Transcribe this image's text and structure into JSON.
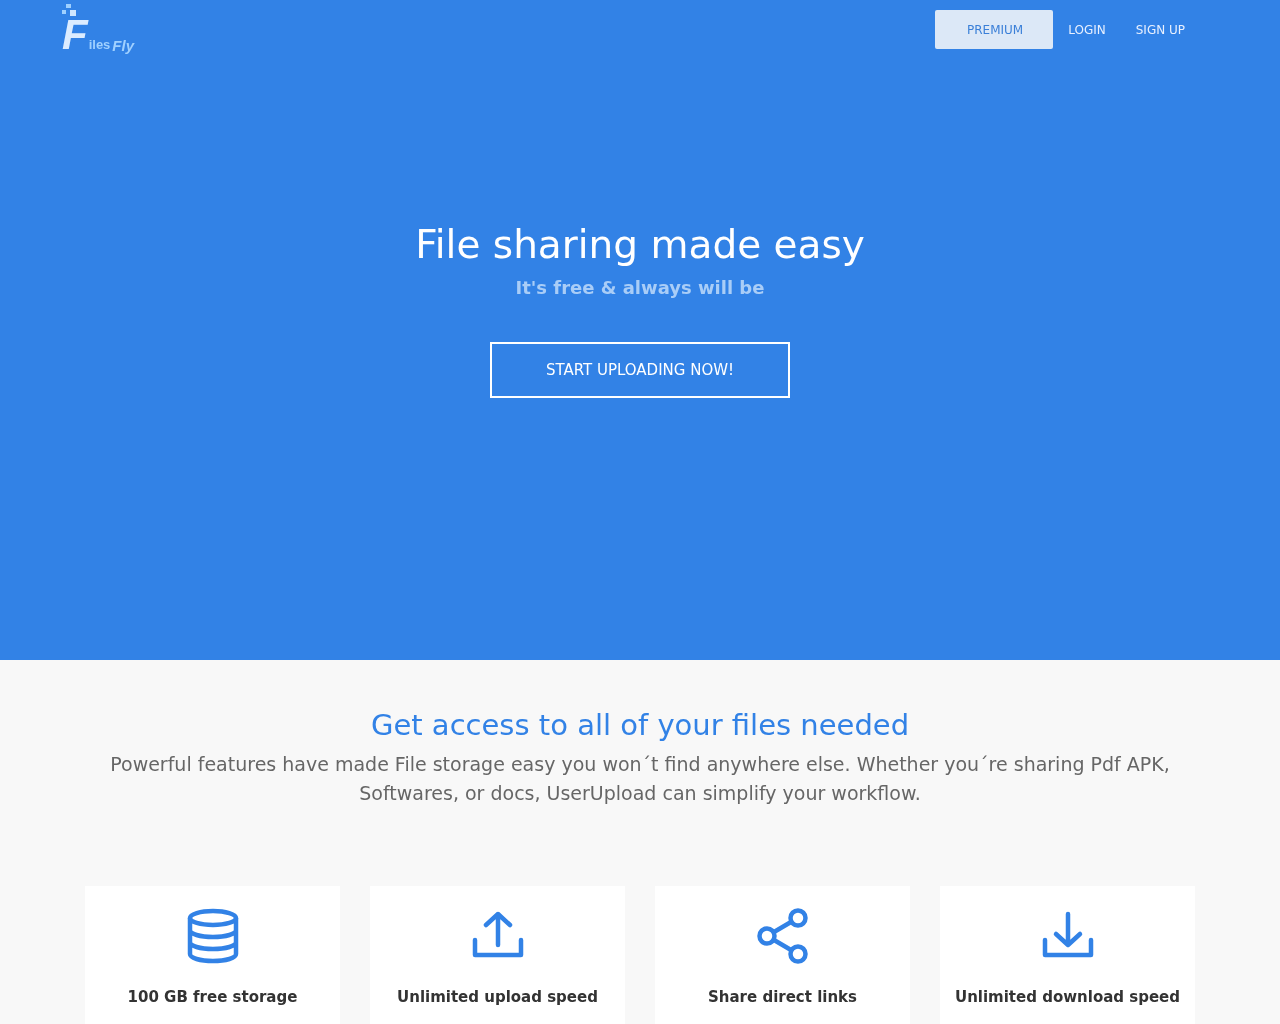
{
  "logo": {
    "initial": "F",
    "rest": "iles",
    "accent": "Fly"
  },
  "nav": [
    {
      "label": "PREMIUM",
      "kind": "highlight"
    },
    {
      "label": "LOGIN",
      "kind": "link"
    },
    {
      "label": "SIGN UP",
      "kind": "link"
    }
  ],
  "hero": {
    "title": "File sharing made easy",
    "subtitle": "It's free & always will be",
    "cta": "START UPLOADING NOW!"
  },
  "features_section": {
    "heading": "Get access to all of your files needed",
    "description": "Powerful features have made File storage easy you won´t find anywhere else. Whether you´re sharing Pdf APK, Softwares, or docs, UserUpload can simplify your workflow."
  },
  "features": [
    {
      "kind": "storage",
      "label": "100 GB free storage"
    },
    {
      "kind": "upload",
      "label": "Unlimited upload speed"
    },
    {
      "kind": "share",
      "label": "Share direct links"
    },
    {
      "kind": "download",
      "label": "Unlimited download speed"
    }
  ]
}
